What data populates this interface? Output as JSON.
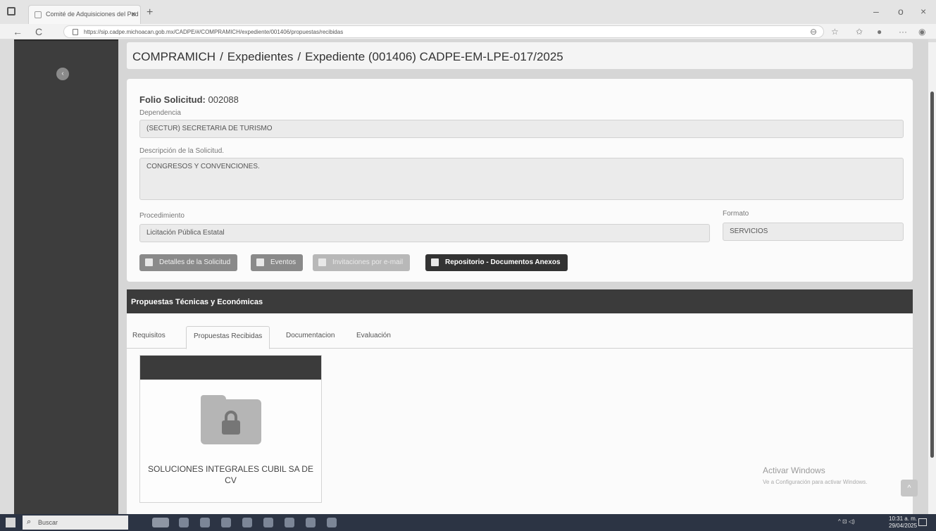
{
  "browser": {
    "tab_title": "Comité de Adquisiciones del Pod",
    "tab_close": "×",
    "new_tab": "+",
    "url": "https://sip.cadpe.michoacan.gob.mx/CADPE/#/COMPRAMICH/expediente/001406/propuestas/recibidas",
    "window_controls": [
      "–",
      "o",
      "×"
    ],
    "back": "←",
    "reload": "C",
    "more": "···"
  },
  "sidebar": {
    "collapse": "‹"
  },
  "breadcrumb": {
    "items": [
      "COMPRAMICH",
      "Expedientes",
      "Expediente (001406) CADPE-EM-LPE-017/2025"
    ],
    "separator": "/"
  },
  "solicitud": {
    "folio_label": "Folio Solicitud:",
    "folio_value": "002088",
    "dependencia_label": "Dependencia",
    "dependencia_value": "(SECTUR) SECRETARIA DE TURISMO",
    "descripcion_label": "Descripción de la Solicitud.",
    "descripcion_value": "CONGRESOS Y CONVENCIONES.",
    "procedimiento_label": "Procedimiento",
    "procedimiento_value": "Licitación Pública Estatal",
    "formato_label": "Formato",
    "formato_value": "SERVICIOS"
  },
  "buttons": {
    "detalles": "Detalles de la Solicitud",
    "eventos": "Eventos",
    "invitaciones": "Invitaciones por e-mail",
    "repositorio": "Repositorio - Documentos Anexos"
  },
  "propuestas": {
    "title": "Propuestas Técnicas y Económicas",
    "tabs": [
      "Requisitos",
      "Propuestas Recibidas",
      "Documentacion",
      "Evaluación"
    ],
    "active_tab": "Propuestas Recibidas",
    "cards": [
      {
        "name": "SOLUCIONES INTEGRALES CUBIL SA DE CV"
      }
    ]
  },
  "watermark": {
    "line1": "Activar Windows",
    "line2": "Ve a Configuración para activar Windows."
  },
  "scroll_top": "^",
  "taskbar": {
    "search_placeholder": "Buscar",
    "search_icon": "⌕",
    "time": "10:31 a. m.",
    "date": "29/04/2025",
    "tray": "^ ⊡ ◁)"
  }
}
